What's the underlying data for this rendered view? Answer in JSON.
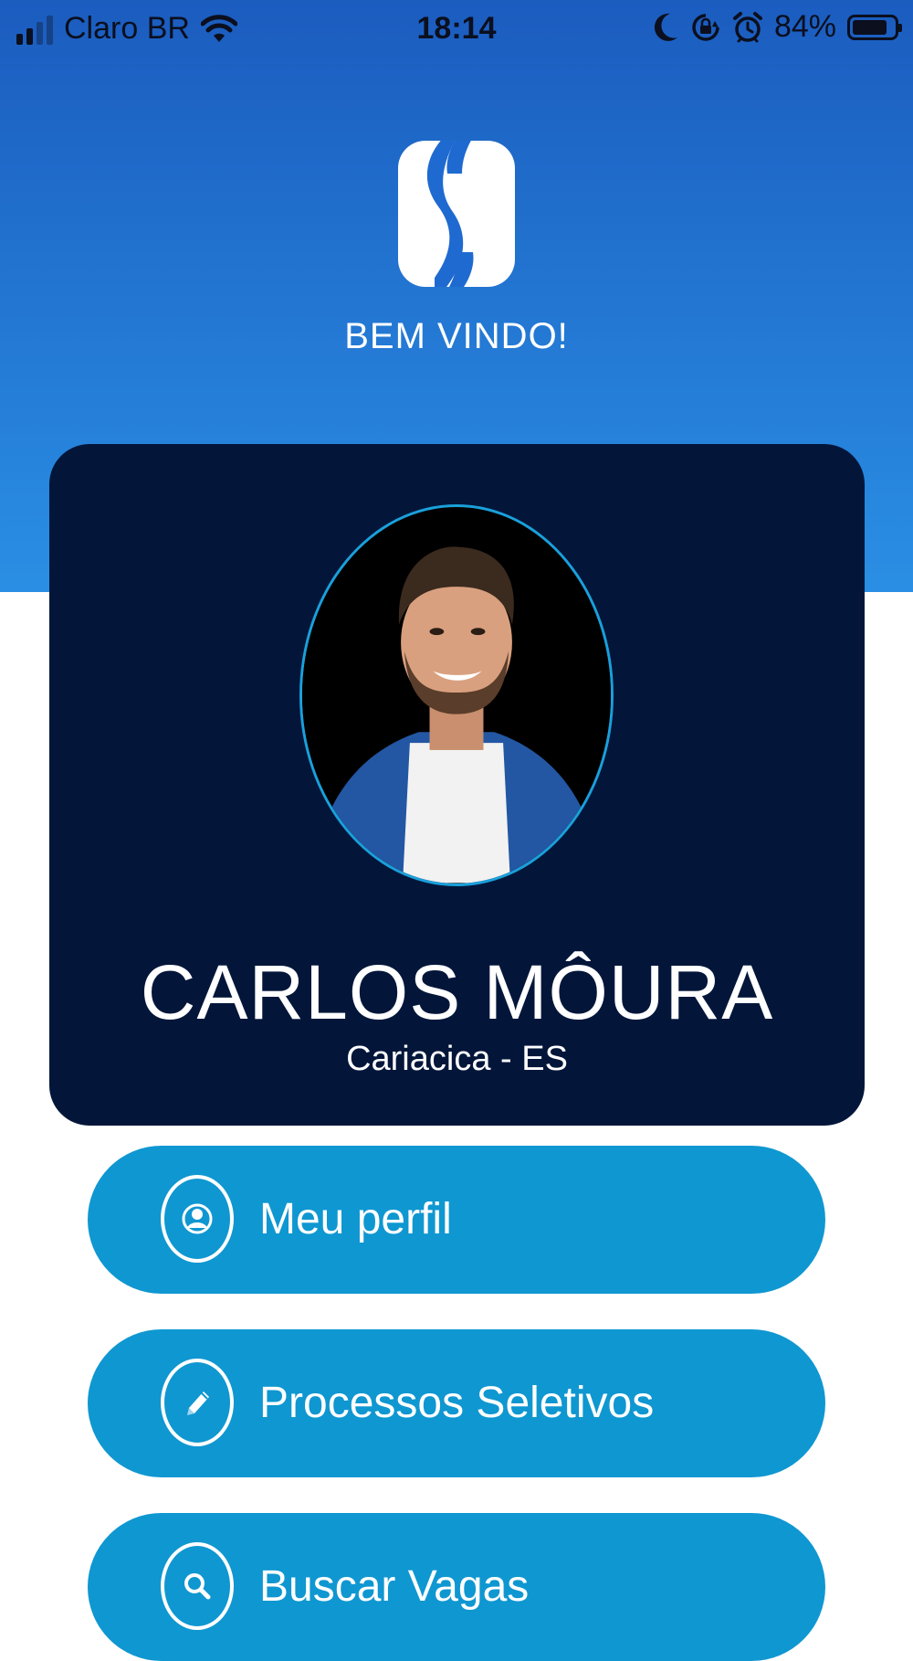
{
  "status_bar": {
    "carrier": "Claro BR",
    "time": "18:14",
    "battery_percent": "84%",
    "battery_level": 0.84,
    "icons": [
      "signal-icon",
      "wifi-icon",
      "moon-icon",
      "orientation-lock-icon",
      "alarm-icon",
      "battery-icon"
    ]
  },
  "header": {
    "logo_icon": "app-logo-icon",
    "welcome_text": "BEM VINDO!"
  },
  "profile": {
    "name": "CARLOS MÔURA",
    "location": "Cariacica - ES"
  },
  "menu": {
    "items": [
      {
        "label": "Meu perfil",
        "icon": "user-icon"
      },
      {
        "label": "Processos Seletivos",
        "icon": "pencil-icon"
      },
      {
        "label": "Buscar Vagas",
        "icon": "search-icon"
      }
    ]
  },
  "colors": {
    "header_gradient_top": "#1b5cbf",
    "header_gradient_bottom": "#2a8fe4",
    "card_background": "#03163a",
    "button_background": "#0f97d1",
    "avatar_border": "#1aa0db"
  }
}
